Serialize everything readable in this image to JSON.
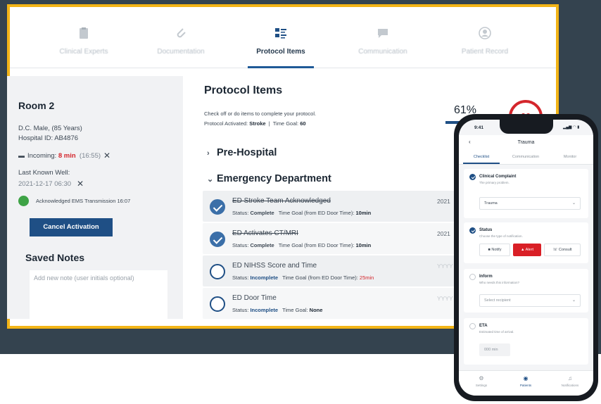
{
  "nav": {
    "tabs": [
      {
        "label": "Clinical Experts",
        "icon": "clipboard-icon"
      },
      {
        "label": "Documentation",
        "icon": "paperclip-icon"
      },
      {
        "label": "Protocol Items",
        "icon": "checklist-icon",
        "active": true
      },
      {
        "label": "Communication",
        "icon": "chat-icon"
      },
      {
        "label": "Patient Record",
        "icon": "user-icon"
      }
    ]
  },
  "patient": {
    "room": "Room 2",
    "demographics": "D.C. Male, (85 Years)",
    "hospital_id": "Hospital ID: AB4876",
    "incoming_label": "Incoming:",
    "incoming_time": "8 min",
    "incoming_clock": "(16:55)",
    "last_known_label": "Last Known Well:",
    "last_known_value": "2021-12-17 06:30",
    "ack_text": "Acknowledged EMS Transmission 16:07",
    "cancel_button": "Cancel Activation",
    "saved_notes_title": "Saved Notes",
    "notes_placeholder": "Add new note (user initials optional)"
  },
  "protocol": {
    "title": "Protocol Items",
    "description": "Check off or do items to complete your protocol.",
    "activated_label": "Protocol Activated:",
    "activated_value": "Stroke",
    "time_goal_label": "Time Goal:",
    "time_goal_value": "60",
    "progress_percent": "61%",
    "gauge_value": "60",
    "sections": [
      {
        "title": "Pre-Hospital",
        "expanded": false
      },
      {
        "title": "Emergency Department",
        "expanded": true
      }
    ],
    "items": [
      {
        "name": "ED Stroke Team Acknowledged",
        "status_label": "Status:",
        "status": "Complete",
        "goal_label": "Time Goal (from ED Door Time):",
        "goal": "10min",
        "date": "2021",
        "done": true
      },
      {
        "name": "ED Activates CT/MRI",
        "status_label": "Status:",
        "status": "Complete",
        "goal_label": "Time Goal (from ED Door Time):",
        "goal": "10min",
        "date": "2021",
        "done": true
      },
      {
        "name": "ED NIHSS Score and Time",
        "status_label": "Status:",
        "status": "Incomplete",
        "goal_label": "Time Goal (from ED Door Time):",
        "goal": "25min",
        "date": "YYYY",
        "done": false
      },
      {
        "name": "ED Door Time",
        "status_label": "Status:",
        "status": "Incomplete",
        "goal_label": "Time Goal:",
        "goal": "None",
        "date": "YYYY",
        "done": false
      }
    ]
  },
  "phone": {
    "time": "9:41",
    "status_icons": "▂▄▆ ◠ ▮",
    "title": "Trauma",
    "tabs": [
      "Checklist",
      "Communication",
      "Monitor"
    ],
    "cards": {
      "complaint": {
        "title": "Clinical Complaint",
        "subtitle": "The primary problem.",
        "value": "Trauma"
      },
      "status": {
        "title": "Status",
        "subtitle": "Choose the type of notification.",
        "buttons": [
          "Notify",
          "Alert",
          "Consult"
        ]
      },
      "inform": {
        "title": "Inform",
        "subtitle": "Who needs this information?",
        "placeholder": "Select recipient"
      },
      "eta": {
        "title": "ETA",
        "subtitle": "Estimated time of arrival.",
        "value": "000 min"
      }
    },
    "bottom_nav": [
      "Settings",
      "Patients",
      "Notifications"
    ]
  },
  "colors": {
    "frame_border": "#f2b417",
    "background_dark": "#34434f",
    "primary_blue": "#1f4f85",
    "alert_red": "#d91f26",
    "success_green": "#3ea346"
  }
}
